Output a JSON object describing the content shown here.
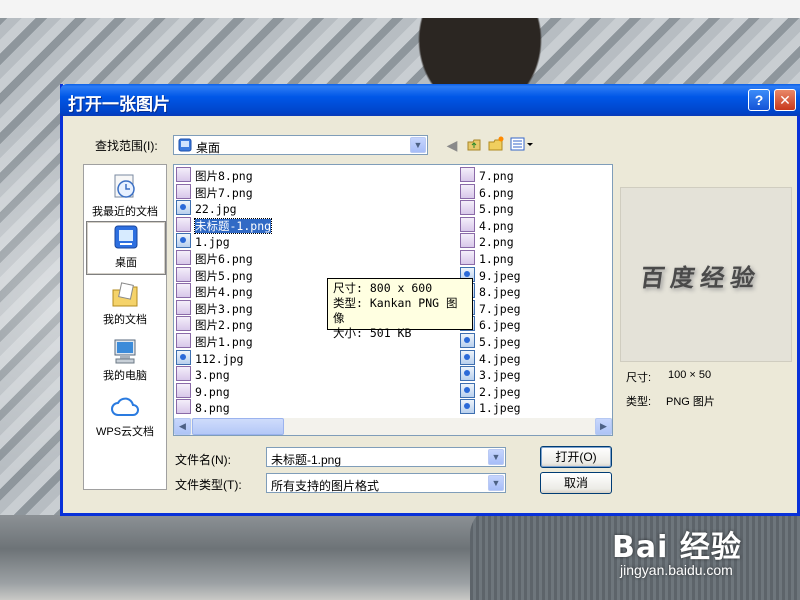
{
  "dialog": {
    "title": "打开一张图片",
    "help_glyph": "?",
    "close_glyph": "✕"
  },
  "lookin": {
    "label": "查找范围(I):",
    "value": "桌面"
  },
  "toolbar": {
    "back_icon": "back-arrow-icon",
    "up_icon": "up-folder-icon",
    "new_folder_icon": "new-folder-icon",
    "views_icon": "views-menu-icon"
  },
  "places": [
    {
      "label": "我最近的文档",
      "icon": "recent-documents-icon"
    },
    {
      "label": "桌面",
      "icon": "desktop-icon"
    },
    {
      "label": "我的文档",
      "icon": "my-documents-icon"
    },
    {
      "label": "我的电脑",
      "icon": "my-computer-icon"
    },
    {
      "label": "WPS云文档",
      "icon": "cloud-icon"
    }
  ],
  "files_left": [
    {
      "name": "图片8.png",
      "type": "png"
    },
    {
      "name": "图片7.png",
      "type": "png"
    },
    {
      "name": "22.jpg",
      "type": "jpg"
    },
    {
      "name": "未标题-1.png",
      "type": "png",
      "selected": true
    },
    {
      "name": "1.jpg",
      "type": "jpg"
    },
    {
      "name": "图片6.png",
      "type": "png"
    },
    {
      "name": "图片5.png",
      "type": "png"
    },
    {
      "name": "图片4.png",
      "type": "png"
    },
    {
      "name": "图片3.png",
      "type": "png"
    },
    {
      "name": "图片2.png",
      "type": "png"
    },
    {
      "name": "图片1.png",
      "type": "png"
    },
    {
      "name": "112.jpg",
      "type": "jpg"
    },
    {
      "name": "3.png",
      "type": "png"
    },
    {
      "name": "9.png",
      "type": "png"
    },
    {
      "name": "8.png",
      "type": "png"
    }
  ],
  "files_right": [
    {
      "name": "7.png",
      "type": "png"
    },
    {
      "name": "6.png",
      "type": "png"
    },
    {
      "name": "5.png",
      "type": "png"
    },
    {
      "name": "4.png",
      "type": "png"
    },
    {
      "name": "2.png",
      "type": "png"
    },
    {
      "name": "1.png",
      "type": "png"
    },
    {
      "name": "9.jpeg",
      "type": "jpg"
    },
    {
      "name": "8.jpeg",
      "type": "jpg"
    },
    {
      "name": "7.jpeg",
      "type": "jpg"
    },
    {
      "name": "6.jpeg",
      "type": "jpg"
    },
    {
      "name": "5.jpeg",
      "type": "jpg"
    },
    {
      "name": "4.jpeg",
      "type": "jpg"
    },
    {
      "name": "3.jpeg",
      "type": "jpg"
    },
    {
      "name": "2.jpeg",
      "type": "jpg"
    },
    {
      "name": "1.jpeg",
      "type": "jpg"
    }
  ],
  "tooltip": {
    "line1": "尺寸: 800 x 600",
    "line2": "类型: Kankan PNG 图像",
    "line3": "大小: 501 KB"
  },
  "preview": {
    "image_text": "百度经验",
    "size_label": "尺寸:",
    "size_value": "100 × 50",
    "type_label": "类型:",
    "type_value": "PNG 图片"
  },
  "filename": {
    "label": "文件名(N):",
    "value": "未标题-1.png"
  },
  "filetype": {
    "label": "文件类型(T):",
    "value": "所有支持的图片格式"
  },
  "buttons": {
    "open": "打开(O)",
    "cancel": "取消"
  },
  "watermark": {
    "logo": "Bai 经验",
    "url": "jingyan.baidu.com"
  },
  "colors": {
    "title_bar": "#0054e3",
    "selection": "#316ac5",
    "dialog_bg": "#ece9d8"
  }
}
